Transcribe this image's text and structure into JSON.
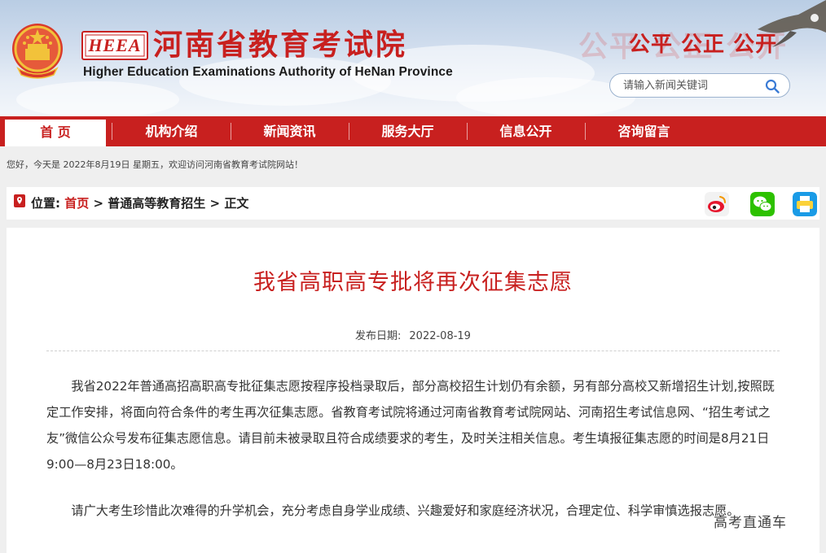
{
  "header": {
    "logo_text": "HEEA",
    "site_name_cn": "河南省教育考试院",
    "site_name_en": "Higher Education Examinations Authority of HeNan Province",
    "slogan": "公平 公正 公开",
    "slogan_ghost": "公平 公正 公开",
    "search_placeholder": "请输入新闻关键词"
  },
  "nav": {
    "items": [
      {
        "label": "首 页",
        "active": true
      },
      {
        "label": "机构介绍"
      },
      {
        "label": "新闻资讯"
      },
      {
        "label": "服务大厅"
      },
      {
        "label": "信息公开"
      },
      {
        "label": "咨询留言"
      }
    ]
  },
  "welcome": "您好，今天是 2022年8月19日 星期五，欢迎访问河南省教育考试院网站！",
  "breadcrumb": {
    "label": "位置:",
    "home": "首页",
    "sep": ">",
    "section": "普通高等教育招生",
    "current": "正文"
  },
  "share_icons": [
    "weibo-icon",
    "wechat-icon",
    "print-icon"
  ],
  "colors": {
    "brand_red": "#c8201f"
  },
  "article": {
    "title": "我省高职高专批将再次征集志愿",
    "date_label": "发布日期:",
    "date": "2022-08-19",
    "paragraphs": [
      "我省2022年普通高招高职高专批征集志愿按程序投档录取后，部分高校招生计划仍有余额，另有部分高校又新增招生计划,按照既定工作安排，将面向符合条件的考生再次征集志愿。省教育考试院将通过河南省教育考试院网站、河南招生考试信息网、“招生考试之友”微信公众号发布征集志愿信息。请目前未被录取且符合成绩要求的考生，及时关注相关信息。考生填报征集志愿的时间是8月21日9:00—8月23日18:00。",
      "请广大考生珍惜此次难得的升学机会，充分考虑自身学业成绩、兴趣爱好和家庭经济状况，合理定位、科学审慎选报志愿。"
    ]
  },
  "watermark": "高考直通车"
}
